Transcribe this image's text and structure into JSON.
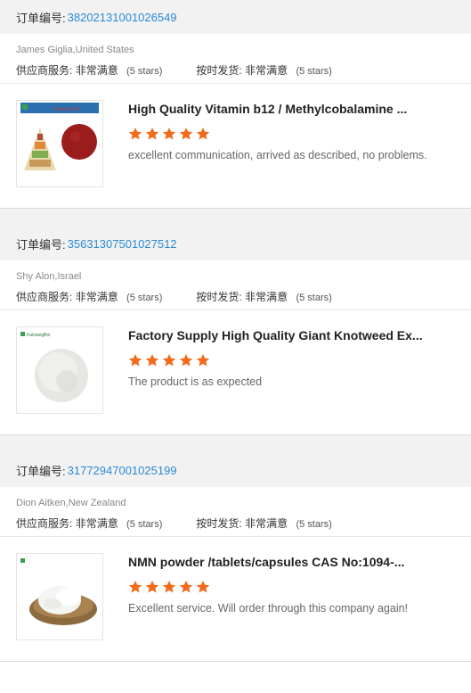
{
  "reviews": [
    {
      "order_label": "订单编号:",
      "order_number": "38202131001026549",
      "buyer": "James Giglia,United States",
      "supplier_label": "供应商服务:",
      "supplier_value": "非常满意",
      "supplier_stars": "(5 stars)",
      "shipping_label": "按时发货:",
      "shipping_value": "非常满意",
      "shipping_stars": "(5 stars)",
      "product_title": "High Quality Vitamin b12 / Methylcobalamine ...",
      "thumb_label": "Vitamin B12",
      "rating": 5,
      "comment": "excellent communication, arrived as described, no problems."
    },
    {
      "order_label": "订单编号:",
      "order_number": "35631307501027512",
      "buyer": "Shy Alon,Israel",
      "supplier_label": "供应商服务:",
      "supplier_value": "非常满意",
      "supplier_stars": "(5 stars)",
      "shipping_label": "按时发货:",
      "shipping_value": "非常满意",
      "shipping_stars": "(5 stars)",
      "product_title": "Factory Supply High Quality Giant Knotweed Ex...",
      "thumb_label": "KaixiangBio",
      "rating": 5,
      "comment": "The product is as expected"
    },
    {
      "order_label": "订单编号:",
      "order_number": "31772947001025199",
      "buyer": "Dion Aitken,New Zealand",
      "supplier_label": "供应商服务:",
      "supplier_value": "非常满意",
      "supplier_stars": "(5 stars)",
      "shipping_label": "按时发货:",
      "shipping_value": "非常满意",
      "shipping_stars": "(5 stars)",
      "product_title": "NMN powder /tablets/capsules CAS No:1094-...",
      "thumb_label": "",
      "rating": 5,
      "comment": "Excellent service. Will order through this company again!"
    }
  ],
  "colors": {
    "star": "#f26b1d",
    "order_number": "#2a8ad4",
    "bar": "#f2f2f2"
  },
  "icons": {
    "star": "star-icon",
    "logo": "leaf-logo-icon"
  }
}
